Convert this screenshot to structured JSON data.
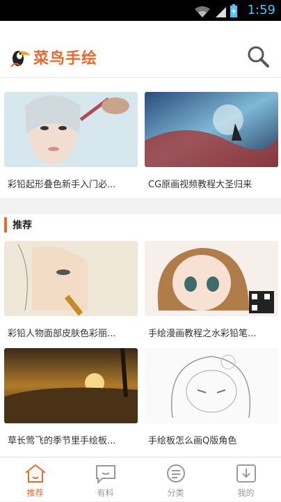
{
  "status": {
    "time": "1:59"
  },
  "app": {
    "name": "菜鸟手绘"
  },
  "top_cards": [
    {
      "title": "彩铅起形叠色新手入门必..."
    },
    {
      "title": "CG原画视频教程大圣归来"
    }
  ],
  "section": {
    "title": "推荐"
  },
  "recommended": [
    {
      "title": "彩铅人物面部皮肤色彩丽..."
    },
    {
      "title": "手绘漫画教程之水彩铅笔..."
    },
    {
      "title": "草长莺飞的季节里手绘板..."
    },
    {
      "title": "手绘板怎么画Q版角色"
    }
  ],
  "tabs": [
    {
      "label": "推荐",
      "icon": "home-icon",
      "active": true
    },
    {
      "label": "有料",
      "icon": "chat-bubble-icon",
      "active": false
    },
    {
      "label": "分类",
      "icon": "category-list-icon",
      "active": false
    },
    {
      "label": "我的",
      "icon": "download-icon",
      "active": false
    }
  ],
  "colors": {
    "accent": "#e8692e",
    "inactive": "#999999"
  }
}
